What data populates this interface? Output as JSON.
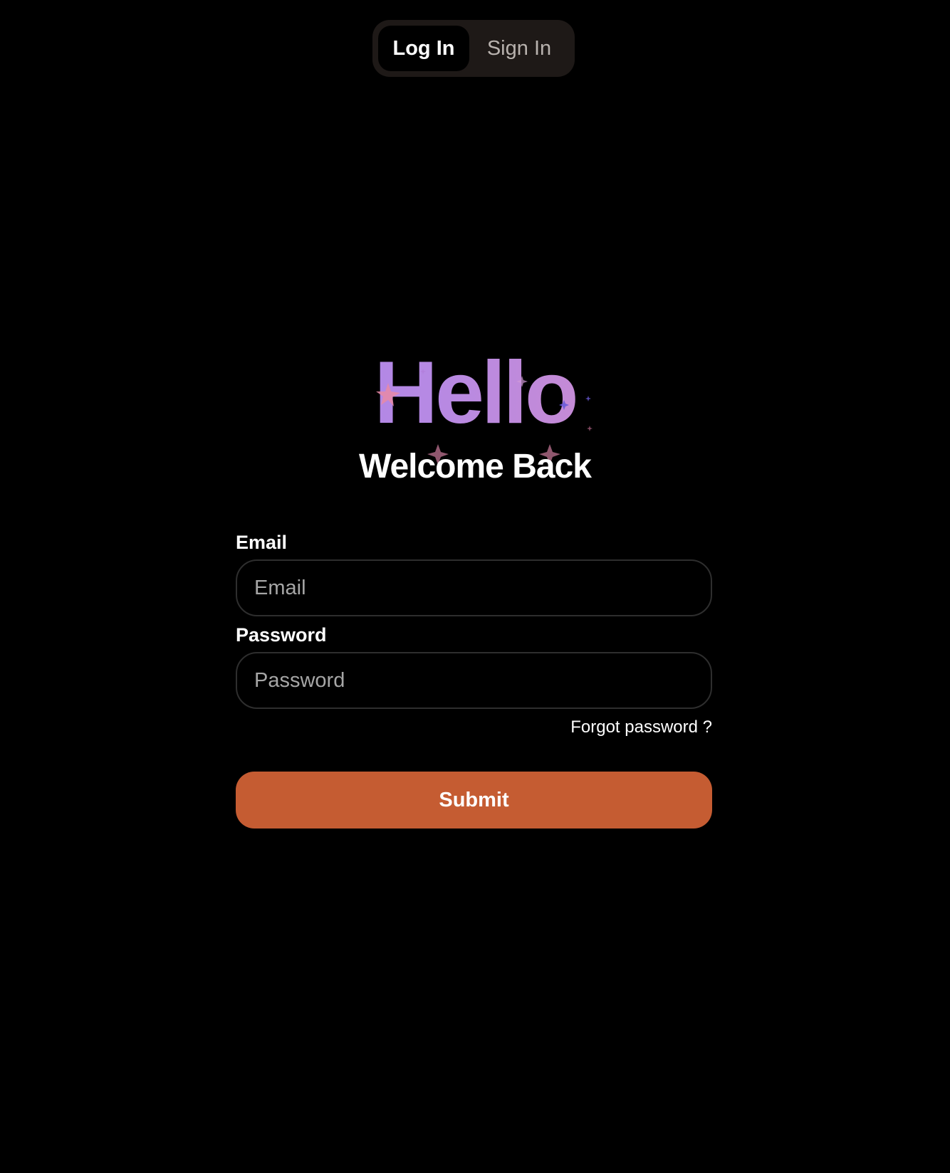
{
  "tabs": [
    {
      "label": "Log In",
      "active": true
    },
    {
      "label": "Sign In",
      "active": false
    }
  ],
  "hero": {
    "title": "Hello",
    "subtitle": "Welcome Back"
  },
  "form": {
    "email_label": "Email",
    "email_placeholder": "Email",
    "email_value": "",
    "password_label": "Password",
    "password_placeholder": "Password",
    "password_value": "",
    "forgot_link": "Forgot password ?",
    "submit_label": "Submit"
  },
  "colors": {
    "background": "#000000",
    "tab_track": "#1e1917",
    "submit": "#c55c32",
    "gradient_start": "#9b7af0",
    "gradient_end": "#e98fb2"
  }
}
